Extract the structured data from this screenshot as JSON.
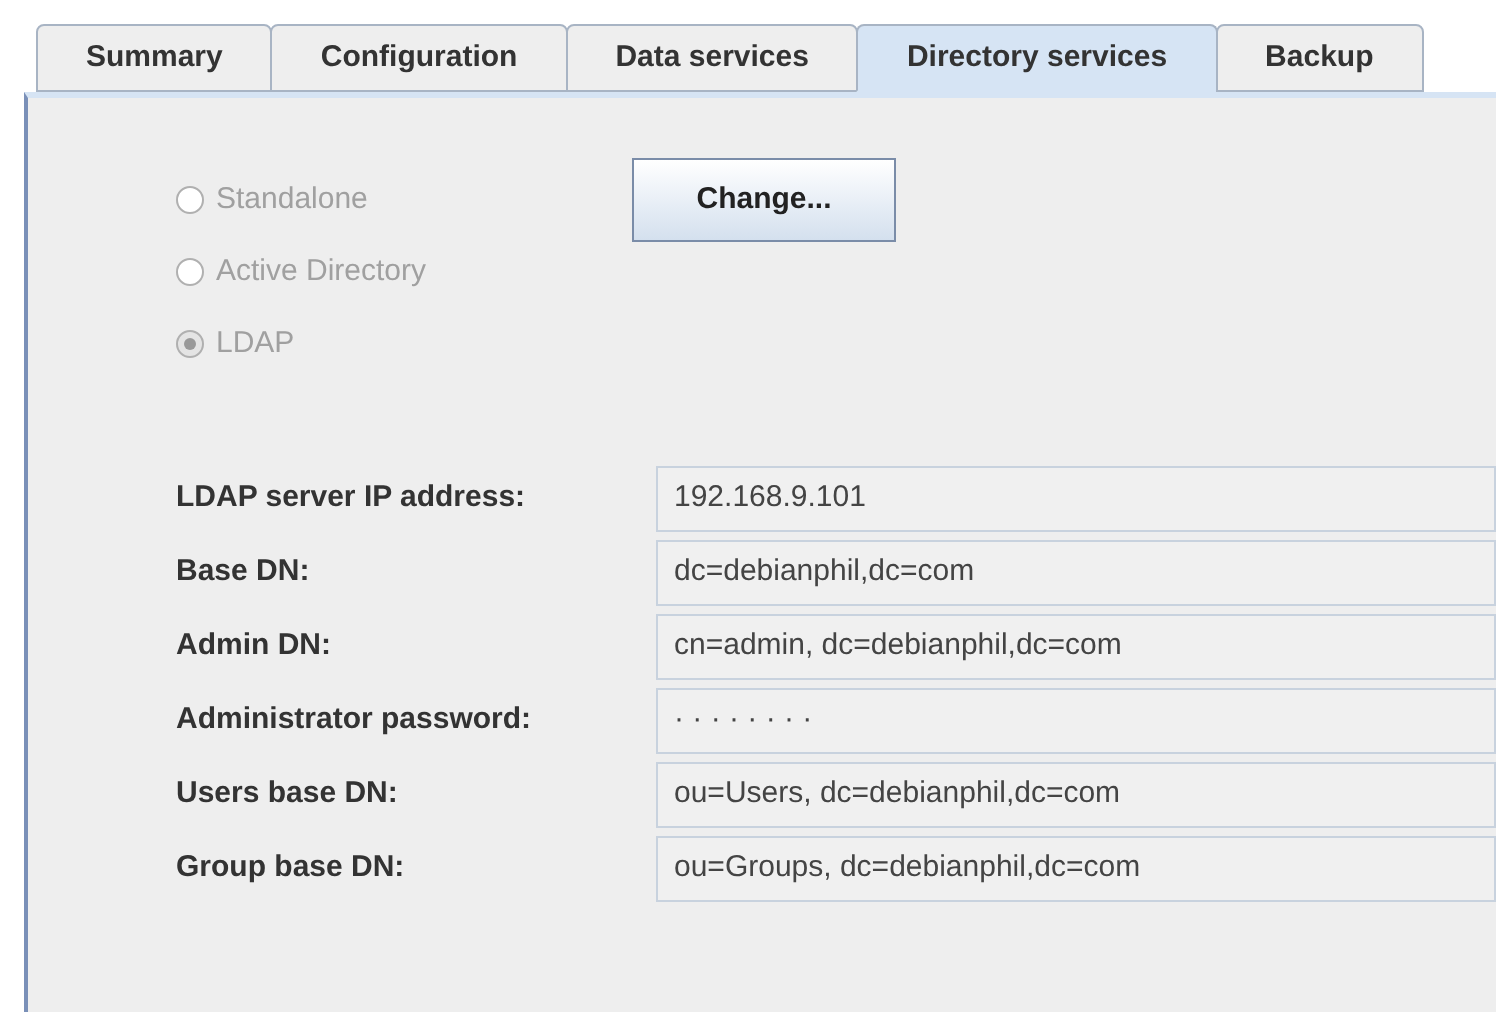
{
  "tabs": [
    {
      "label": "Summary",
      "selected": false
    },
    {
      "label": "Configuration",
      "selected": false
    },
    {
      "label": "Data services",
      "selected": false
    },
    {
      "label": "Directory services",
      "selected": true
    },
    {
      "label": "Backup",
      "selected": false
    }
  ],
  "directory_type": [
    {
      "label": "Standalone",
      "selected": false,
      "disabled": true
    },
    {
      "label": "Active Directory",
      "selected": false,
      "disabled": true
    },
    {
      "label": "LDAP",
      "selected": true,
      "disabled": true
    }
  ],
  "change_button": "Change...",
  "fields": [
    {
      "label": "LDAP server IP address:",
      "value": "192.168.9.101"
    },
    {
      "label": "Base DN:",
      "value": "dc=debianphil,dc=com"
    },
    {
      "label": "Admin DN:",
      "value": "cn=admin, dc=debianphil,dc=com"
    },
    {
      "label": "Administrator password:",
      "value": "· · · · · · · ·"
    },
    {
      "label": "Users base DN:",
      "value": "ou=Users, dc=debianphil,dc=com"
    },
    {
      "label": "Group base DN:",
      "value": "ou=Groups, dc=debianphil,dc=com"
    }
  ]
}
